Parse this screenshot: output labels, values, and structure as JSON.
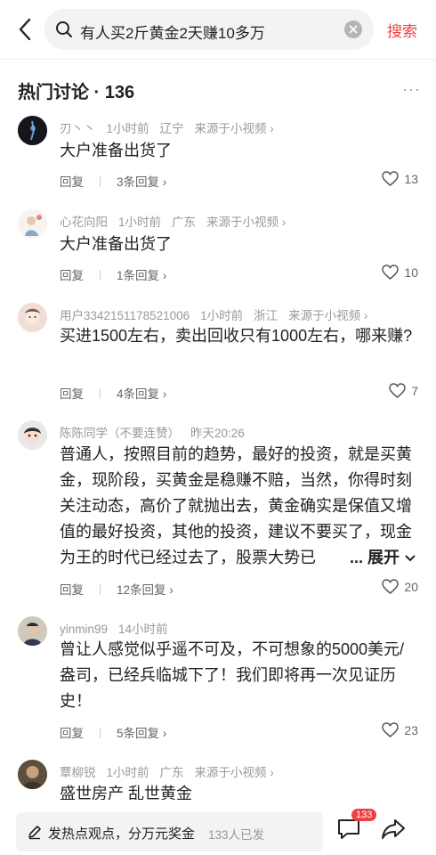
{
  "search": {
    "query": "有人买2斤黄金2天赚10多万",
    "button_label": "搜索"
  },
  "section": {
    "title": "热门讨论 · 136",
    "more": "···"
  },
  "comments": [
    {
      "username": "刃丶丶",
      "time": "1小时前",
      "location": "辽宁",
      "source": "来源于小视频 ›",
      "text": "大户准备出货了",
      "reply_label": "回复",
      "replies": "3条回复 ›",
      "likes": "13"
    },
    {
      "username": "心花向阳",
      "time": "1小时前",
      "location": "广东",
      "source": "来源于小视频 ›",
      "text": "大户准备出货了",
      "reply_label": "回复",
      "replies": "1条回复 ›",
      "likes": "10"
    },
    {
      "username": "用户3342151178521006",
      "time": "1小时前",
      "location": "浙江",
      "source": "来源于小视频 ›",
      "text": "买进1500左右，卖出回收只有1000左右，哪来赚?",
      "reply_label": "回复",
      "replies": "4条回复 ›",
      "likes": "7"
    },
    {
      "username": "陈陈同学（不要连赞）",
      "time": "昨天20:26",
      "location": "",
      "source": "",
      "text": "普通人，按照目前的趋势，最好的投资，就是买黄金，现阶段，买黄金是稳赚不赔，当然，你得时刻关注动态，高价了就抛出去，黄金确实是保值又增值的最好投资，其他的投资，建议不要买了，现金为王的时代已经过去了，股票大势已",
      "expand_label": "... 展开",
      "reply_label": "回复",
      "replies": "12条回复 ›",
      "likes": "20"
    },
    {
      "username": "yinmin99",
      "time": "14小时前",
      "location": "",
      "source": "",
      "text": "曾让人感觉似乎遥不可及，不可想象的5000美元/盎司，已经兵临城下了！我们即将再一次见证历史！",
      "reply_label": "回复",
      "replies": "5条回复 ›",
      "likes": "23"
    },
    {
      "username": "覃柳锐",
      "time": "1小时前",
      "location": "广东",
      "source": "来源于小视频 ›",
      "text": "盛世房产 乱世黄金"
    }
  ],
  "bottom": {
    "post_prompt": "发热点观点，分万元奖金",
    "post_count": "133人已发",
    "comment_badge": "133"
  },
  "colors": {
    "accent": "#f04142",
    "muted": "#999999"
  },
  "icons": [
    "back-arrow-icon",
    "search-icon",
    "clear-icon",
    "more-icon",
    "heart-icon",
    "pen-icon",
    "comment-icon",
    "share-icon"
  ]
}
